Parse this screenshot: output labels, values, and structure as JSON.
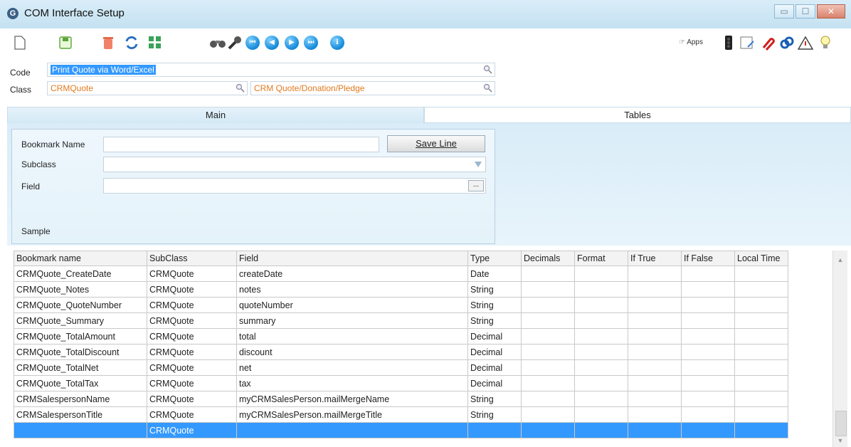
{
  "window": {
    "title": "COM Interface Setup",
    "app_icon": "G"
  },
  "toolbar": {
    "apps_label": "Apps"
  },
  "header": {
    "code_label": "Code",
    "code_value": "Print Quote via Word/Excel",
    "class_label": "Class",
    "class_value": "CRMQuote",
    "class_desc": "CRM Quote/Donation/Pledge"
  },
  "tabs": [
    {
      "label": "Main",
      "active": true
    },
    {
      "label": "Tables",
      "active": false
    }
  ],
  "form": {
    "bookmark_label": "Bookmark Name",
    "bookmark_value": "",
    "save_label": "Save Line",
    "subclass_label": "Subclass",
    "field_label": "Field",
    "ellipsis": "...",
    "sample_label": "Sample"
  },
  "grid": {
    "columns": [
      "Bookmark name",
      "SubClass",
      "Field",
      "Type",
      "Decimals",
      "Format",
      "If True",
      "If False",
      "Local Time"
    ],
    "rows": [
      [
        "CRMQuote_CreateDate",
        "CRMQuote",
        "createDate",
        "Date",
        "",
        "",
        "",
        "",
        ""
      ],
      [
        "CRMQuote_Notes",
        "CRMQuote",
        "notes",
        "String",
        "",
        "",
        "",
        "",
        ""
      ],
      [
        "CRMQuote_QuoteNumber",
        "CRMQuote",
        "quoteNumber",
        "String",
        "",
        "",
        "",
        "",
        ""
      ],
      [
        "CRMQuote_Summary",
        "CRMQuote",
        "summary",
        "String",
        "",
        "",
        "",
        "",
        ""
      ],
      [
        "CRMQuote_TotalAmount",
        "CRMQuote",
        "total",
        "Decimal",
        "",
        "",
        "",
        "",
        ""
      ],
      [
        "CRMQuote_TotalDiscount",
        "CRMQuote",
        "discount",
        "Decimal",
        "",
        "",
        "",
        "",
        ""
      ],
      [
        "CRMQuote_TotalNet",
        "CRMQuote",
        "net",
        "Decimal",
        "",
        "",
        "",
        "",
        ""
      ],
      [
        "CRMQuote_TotalTax",
        "CRMQuote",
        "tax",
        "Decimal",
        "",
        "",
        "",
        "",
        ""
      ],
      [
        "CRMSalespersonName",
        "CRMQuote",
        "myCRMSalesPerson.mailMergeName",
        "String",
        "",
        "",
        "",
        "",
        ""
      ],
      [
        "CRMSalespersonTitle",
        "CRMQuote",
        "myCRMSalesPerson.mailMergeTitle",
        "String",
        "",
        "",
        "",
        "",
        ""
      ],
      [
        "",
        "CRMQuote",
        "",
        "",
        "",
        "",
        "",
        "",
        ""
      ]
    ],
    "selected_row": 10
  },
  "colors": {
    "selection": "#3399ff",
    "link_orange": "#e07b1f",
    "titlebar": "#c4e1f1"
  }
}
